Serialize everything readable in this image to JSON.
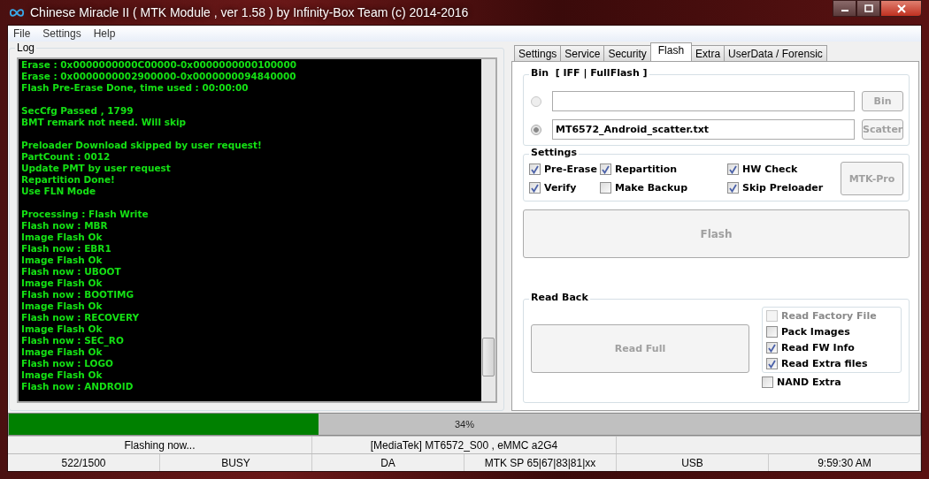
{
  "window": {
    "title": "Chinese Miracle II ( MTK Module , ver 1.58 ) by Infinity-Box Team (c) 2014-2016"
  },
  "menu": [
    "File",
    "Settings",
    "Help"
  ],
  "log": {
    "label": "Log",
    "paragraphs": [
      [
        "Erase : 0x0000000000C00000-0x0000000000100000",
        "Erase : 0x0000000002900000-0x0000000094840000",
        "Flash Pre-Erase Done, time used : 00:00:00"
      ],
      [
        "SecCfg Passed , 1799",
        "BMT remark not need. Will skip"
      ],
      [
        "Preloader Download skipped by user request!",
        "PartCount : 0012",
        "Update PMT by user request",
        "Repartition Done!",
        "Use FLN Mode"
      ],
      [
        "Processing : Flash Write",
        "Flash now : MBR",
        "Image Flash Ok",
        "Flash now : EBR1",
        "Image Flash Ok",
        "Flash now : UBOOT",
        "Image Flash Ok",
        "Flash now : BOOTIMG",
        "Image Flash Ok",
        "Flash now : RECOVERY",
        "Image Flash Ok",
        "Flash now : SEC_RO",
        "Image Flash Ok",
        "Flash now : LOGO",
        "Image Flash Ok",
        "Flash now : ANDROID"
      ]
    ]
  },
  "tabs": [
    {
      "label": "Settings",
      "selected": false
    },
    {
      "label": "Service",
      "selected": false
    },
    {
      "label": "Security",
      "selected": false
    },
    {
      "label": "Flash",
      "selected": true
    },
    {
      "label": "Extra",
      "selected": false
    },
    {
      "label": "UserData / Forensic",
      "selected": false
    }
  ],
  "bin": {
    "title": "Bin  [ IFF | FullFlash ]",
    "rows": [
      {
        "selected": false,
        "value": "",
        "button": "Bin",
        "disabled": true
      },
      {
        "selected": true,
        "value": "MT6572_Android_scatter.txt",
        "button": "Scatter",
        "disabled": true
      }
    ]
  },
  "settings": {
    "title": "Settings",
    "options": [
      {
        "label": "Pre-Erase",
        "checked": true
      },
      {
        "label": "Repartition",
        "checked": true
      },
      {
        "label": "HW Check",
        "checked": true
      },
      {
        "label": "Verify",
        "checked": true
      },
      {
        "label": "Make Backup",
        "checked": false
      },
      {
        "label": "Skip Preloader",
        "checked": true
      }
    ],
    "button": {
      "label": "MTK-Pro",
      "disabled": true
    }
  },
  "flash_button": {
    "label": "Flash",
    "disabled": true
  },
  "read_back": {
    "title": "Read Back",
    "button": {
      "label": "Read Full",
      "disabled": true
    },
    "options": [
      {
        "label": "Read Factory File",
        "checked": false,
        "disabled": true
      },
      {
        "label": "Pack Images",
        "checked": false,
        "disabled": false
      },
      {
        "label": "Read FW Info",
        "checked": true,
        "disabled": false
      },
      {
        "label": "Read Extra files",
        "checked": true,
        "disabled": false
      }
    ],
    "nand_extra": {
      "label": "NAND Extra",
      "checked": false
    }
  },
  "progress": {
    "level": 0.34,
    "text": "34%"
  },
  "status_bar": {
    "row_1": [
      "Flashing now...",
      "[MediaTek] MT6572_S00 , eMMC a2G4"
    ],
    "row_2": [
      "522/1500",
      "BUSY",
      "DA",
      "MTK SP 65|67|83|81|xx",
      "USB",
      "9:59:30 AM"
    ]
  }
}
